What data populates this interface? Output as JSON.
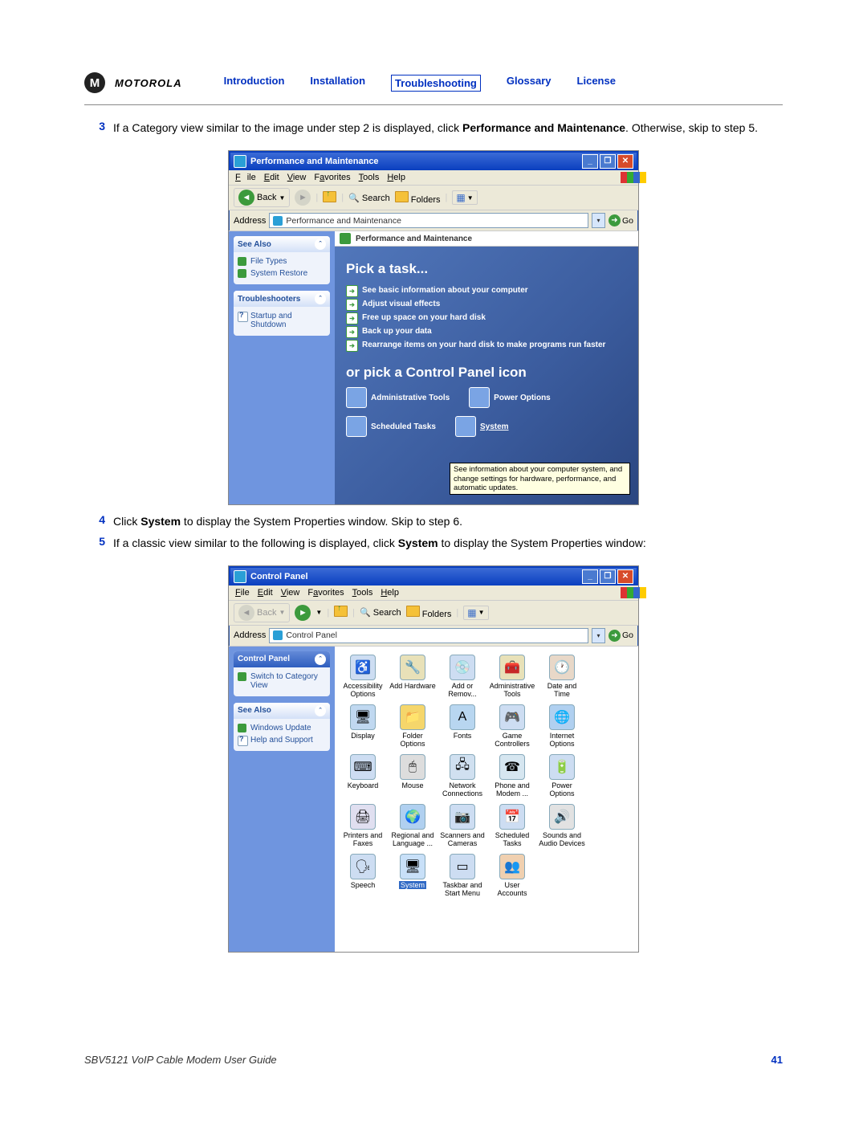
{
  "header": {
    "brand": "MOTOROLA",
    "logo_m": "M",
    "nav": {
      "intro": "Introduction",
      "install": "Installation",
      "trouble": "Troubleshooting",
      "glossary": "Glossary",
      "license": "License"
    }
  },
  "steps": {
    "s3": {
      "num": "3",
      "pre": "If a Category view similar to the image under step 2 is displayed, click ",
      "bold": "Performance and Maintenance",
      "post": ". Otherwise, skip to step 5."
    },
    "s4": {
      "num": "4",
      "pre": "Click ",
      "bold": "System",
      "post": " to display the System Properties window. Skip to step 6."
    },
    "s5": {
      "num": "5",
      "pre": "If a classic view similar to the following is displayed, click ",
      "bold": "System",
      "post": " to display the System Properties window:"
    }
  },
  "win1": {
    "title": "Performance and Maintenance",
    "min": "_",
    "max": "❐",
    "close": "✕",
    "menu": {
      "file": "File",
      "edit": "Edit",
      "view": "View",
      "fav": "Favorites",
      "tools": "Tools",
      "help": "Help"
    },
    "toolbar": {
      "back": "Back",
      "search": "Search",
      "folders": "Folders"
    },
    "address_label": "Address",
    "address_value": "Performance and Maintenance",
    "go": "Go",
    "side": {
      "seealso_title": "See Also",
      "seealso_items": {
        "a": "File Types",
        "b": "System Restore"
      },
      "trouble_title": "Troubleshooters",
      "trouble_items": {
        "a": "Startup and Shutdown"
      }
    },
    "catbar": "Performance and Maintenance",
    "pick": "Pick a task...",
    "tasks": {
      "a": "See basic information about your computer",
      "b": "Adjust visual effects",
      "c": "Free up space on your hard disk",
      "d": "Back up your data",
      "e": "Rearrange items on your hard disk to make programs run faster"
    },
    "orpick": "or pick a Control Panel icon",
    "icons": {
      "admin": "Administrative Tools",
      "power": "Power Options",
      "sched": "Scheduled Tasks",
      "system": "System"
    },
    "tooltip": "See information about your computer system, and change settings for hardware, performance, and automatic updates."
  },
  "win2": {
    "title": "Control Panel",
    "min": "_",
    "max": "❐",
    "close": "✕",
    "menu": {
      "file": "File",
      "edit": "Edit",
      "view": "View",
      "fav": "Favorites",
      "tools": "Tools",
      "help": "Help"
    },
    "toolbar": {
      "back": "Back",
      "search": "Search",
      "folders": "Folders"
    },
    "address_label": "Address",
    "address_value": "Control Panel",
    "go": "Go",
    "side": {
      "cp_title": "Control Panel",
      "cp_link": "Switch to Category View",
      "seealso_title": "See Also",
      "seealso_items": {
        "a": "Windows Update",
        "b": "Help and Support"
      }
    },
    "icons": {
      "access": "Accessibility Options",
      "addhw": "Add Hardware",
      "addrem": "Add or Remov...",
      "admin": "Administrative Tools",
      "date": "Date and Time",
      "display": "Display",
      "folder": "Folder Options",
      "fonts": "Fonts",
      "game": "Game Controllers",
      "inet": "Internet Options",
      "kb": "Keyboard",
      "mouse": "Mouse",
      "net": "Network Connections",
      "phone": "Phone and Modem ...",
      "power": "Power Options",
      "prn": "Printers and Faxes",
      "region": "Regional and Language ...",
      "scan": "Scanners and Cameras",
      "sched": "Scheduled Tasks",
      "sound": "Sounds and Audio Devices",
      "speech": "Speech",
      "system": "System",
      "taskbar": "Taskbar and Start Menu",
      "users": "User Accounts"
    }
  },
  "footer": {
    "title": "SBV5121 VoIP Cable Modem User Guide",
    "page": "41"
  }
}
